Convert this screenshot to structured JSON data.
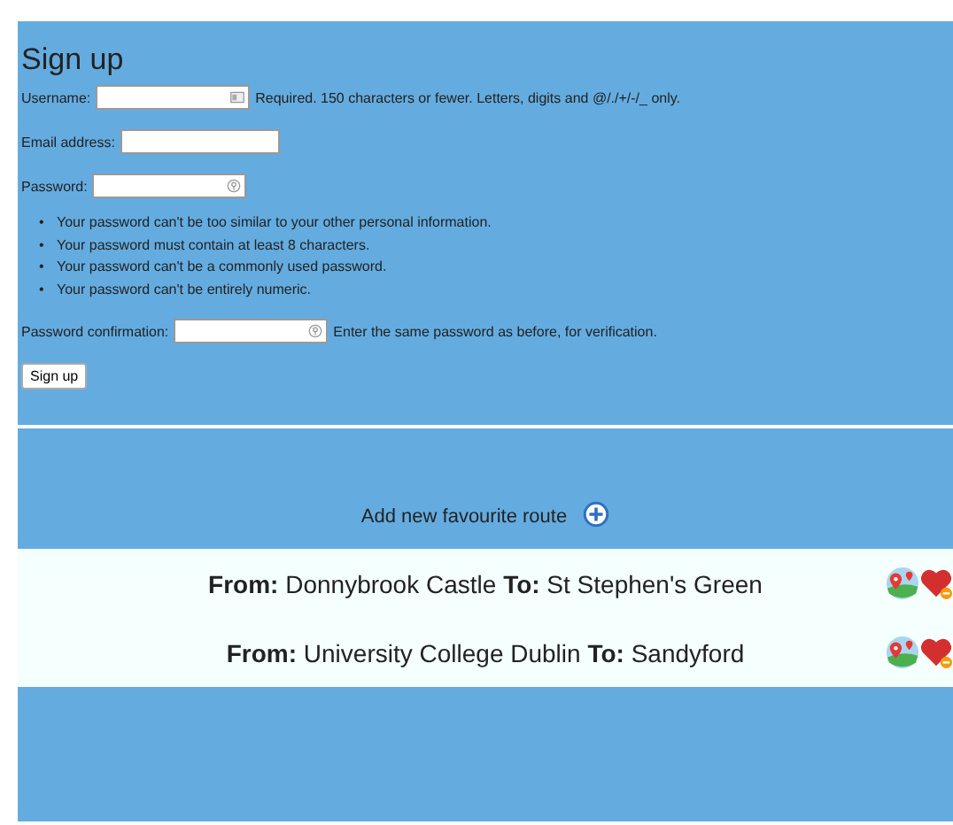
{
  "title": "Sign up",
  "fields": [
    {
      "label": "Username:",
      "kind": "card",
      "help": "Required. 150 characters or fewer. Letters, digits and @/./+/-/_ only."
    },
    {
      "label": "Email address:",
      "kind": "plain"
    },
    {
      "label": "Password:",
      "kind": "key"
    }
  ],
  "password_rules": [
    {
      "marker": "•",
      "text": "Your password can't be too similar to your other personal information."
    },
    {
      "marker": "•",
      "text": "Your password must contain at least 8 characters."
    },
    {
      "marker": "•",
      "text": "Your password can't be a commonly used password."
    },
    {
      "marker": "•",
      "text": "Your password can't be entirely numeric."
    }
  ],
  "confirmation": {
    "label": "Password confirmation:",
    "kind": "key",
    "help": "Enter the same password as before, for verification."
  },
  "submit": "Sign up",
  "add_route": "Add new favourite route",
  "routes": [
    {
      "text": "**From:** Donnybrook Castle **To:** St Stephen's Green"
    },
    {
      "text": "**From:** University College Dublin **To:** Sandyford"
    }
  ]
}
